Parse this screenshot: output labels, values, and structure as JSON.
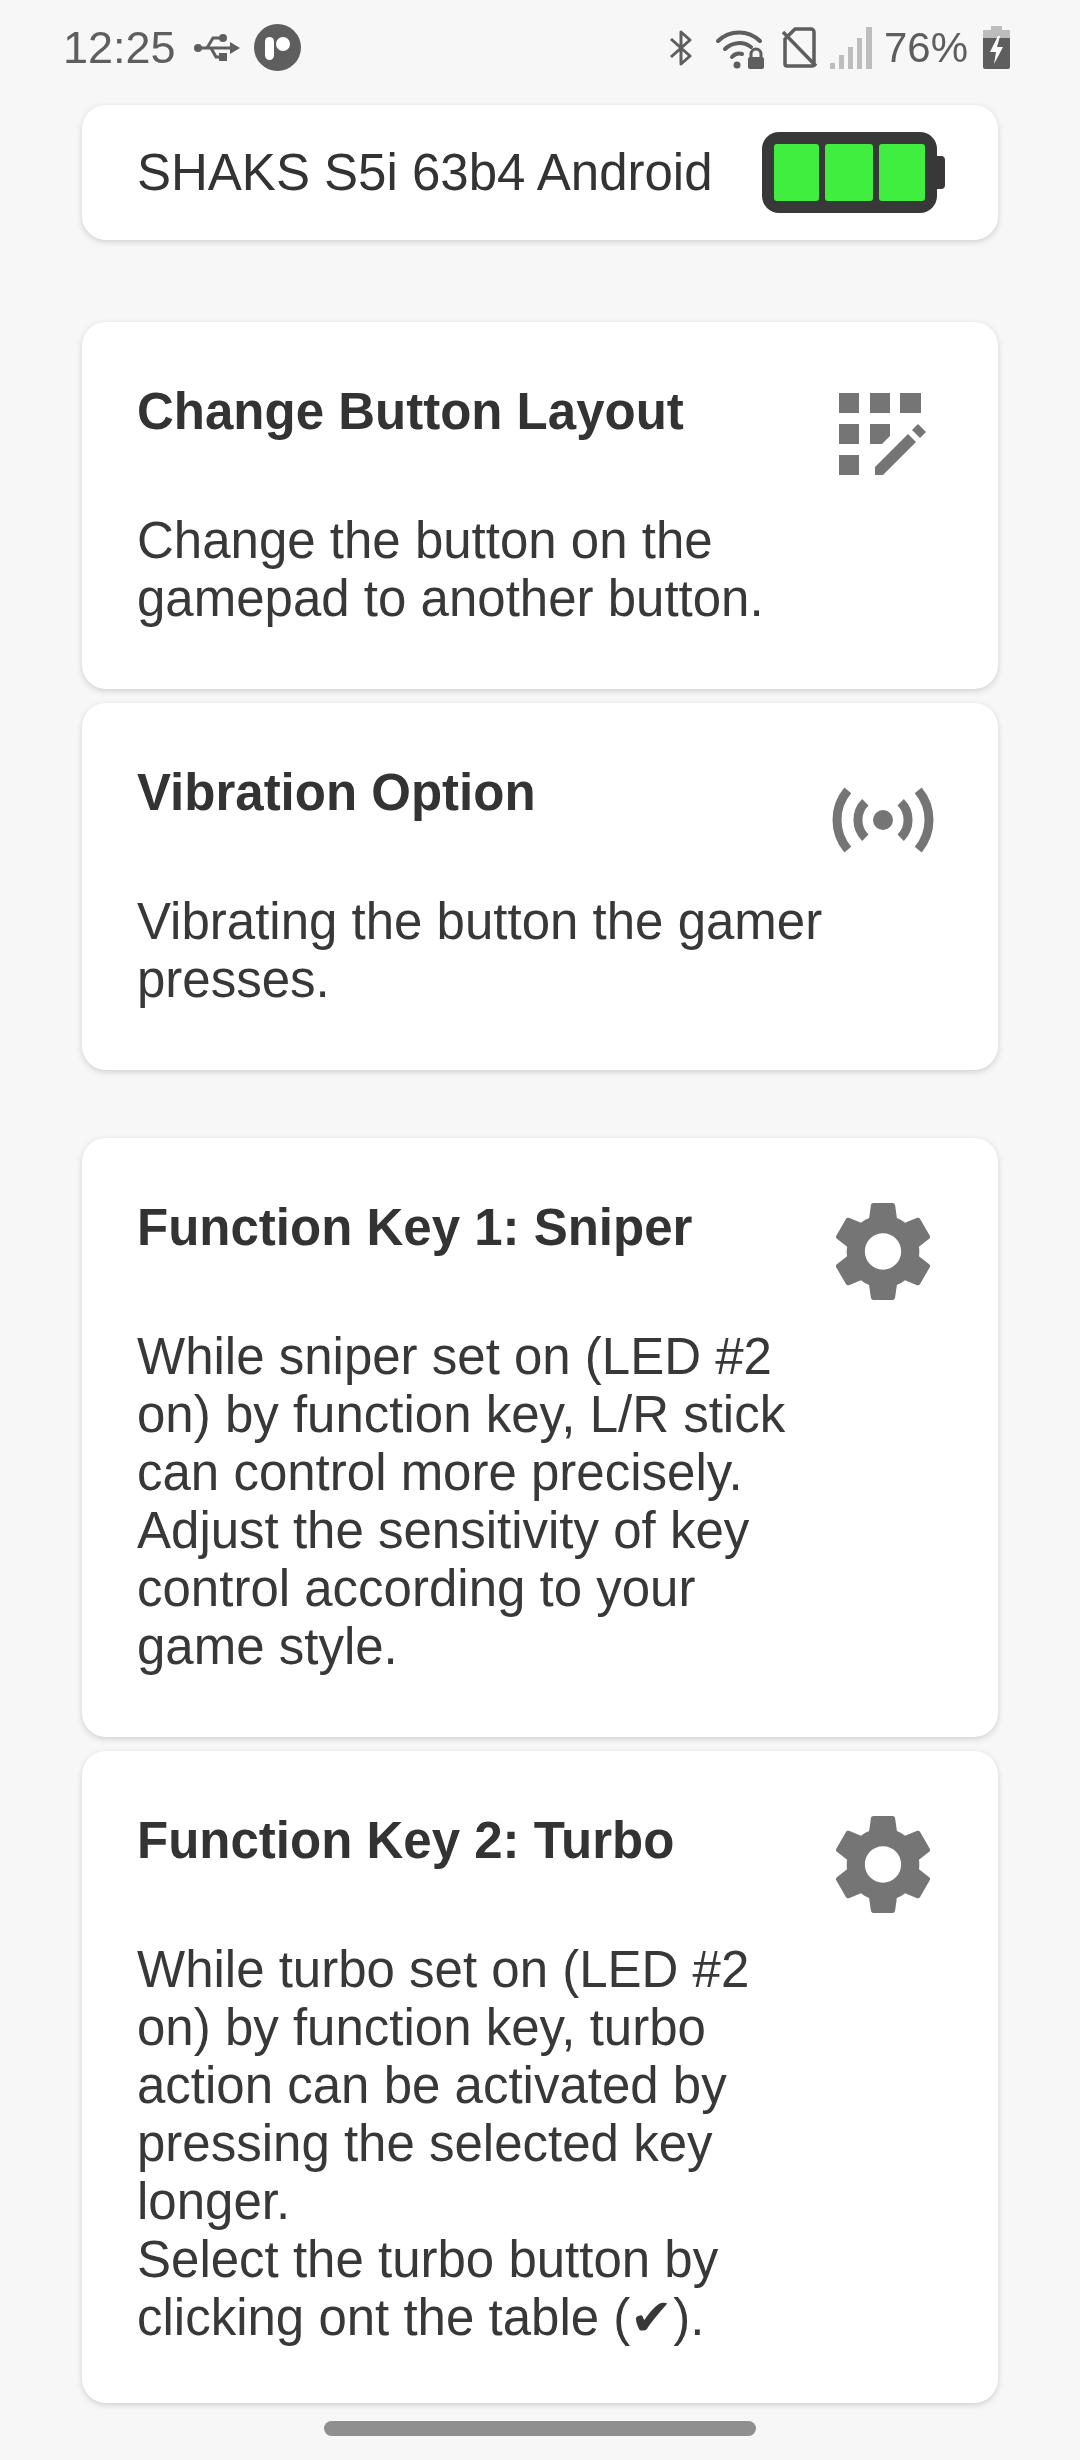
{
  "status_bar": {
    "time": "12:25",
    "battery": "76%"
  },
  "device": {
    "name": "SHAKS S5i 63b4 Android"
  },
  "sections": [
    {
      "cards": [
        {
          "kind": "layout",
          "title": "Change Button Layout",
          "description": "Change the button on the gamepad to another button."
        },
        {
          "kind": "vibration",
          "title": "Vibration Option",
          "description": "Vibrating the button the gamer presses."
        }
      ]
    },
    {
      "cards": [
        {
          "kind": "settings",
          "title": "Function Key 1: Sniper",
          "description": "While sniper set on (LED #2 on) by function key, L/R stick can control more precisely. Adjust the sensitivity of key control according to your game style."
        },
        {
          "kind": "settings",
          "title": "Function Key 2: Turbo",
          "description": "While turbo set on (LED #2 on) by function key, turbo action can be activated by pressing the selected key longer.\nSelect the turbo button by clicking ont the table (✔)."
        }
      ]
    }
  ]
}
